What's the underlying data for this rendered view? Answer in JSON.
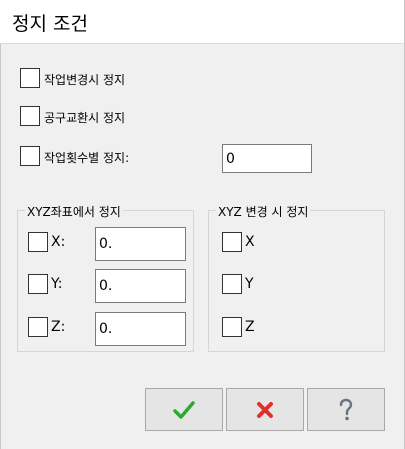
{
  "window": {
    "title": "정지 조건"
  },
  "options": {
    "stop_on_job_change": {
      "label": "작업변경시 정지",
      "checked": false
    },
    "stop_on_tool_change": {
      "label": "공구교환시 정지",
      "checked": false
    },
    "stop_on_job_count": {
      "label": "작업횟수별 정지:",
      "checked": false,
      "value": "0"
    }
  },
  "xyz_coord_group": {
    "title": "XYZ좌표에서 정지",
    "x": {
      "label": "X:",
      "checked": false,
      "value": "0."
    },
    "y": {
      "label": "Y:",
      "checked": false,
      "value": "0."
    },
    "z": {
      "label": "Z:",
      "checked": false,
      "value": "0."
    }
  },
  "xyz_change_group": {
    "title": "XYZ 변경 시 정지",
    "x": {
      "label": "X",
      "checked": false
    },
    "y": {
      "label": "Y",
      "checked": false
    },
    "z": {
      "label": "Z",
      "checked": false
    }
  },
  "buttons": {
    "ok": {
      "icon": "checkmark-icon",
      "color": "#2fa82f"
    },
    "cancel": {
      "icon": "x-icon",
      "color": "#e0302a"
    },
    "help": {
      "icon": "question-icon",
      "color": "#6a7280"
    }
  }
}
